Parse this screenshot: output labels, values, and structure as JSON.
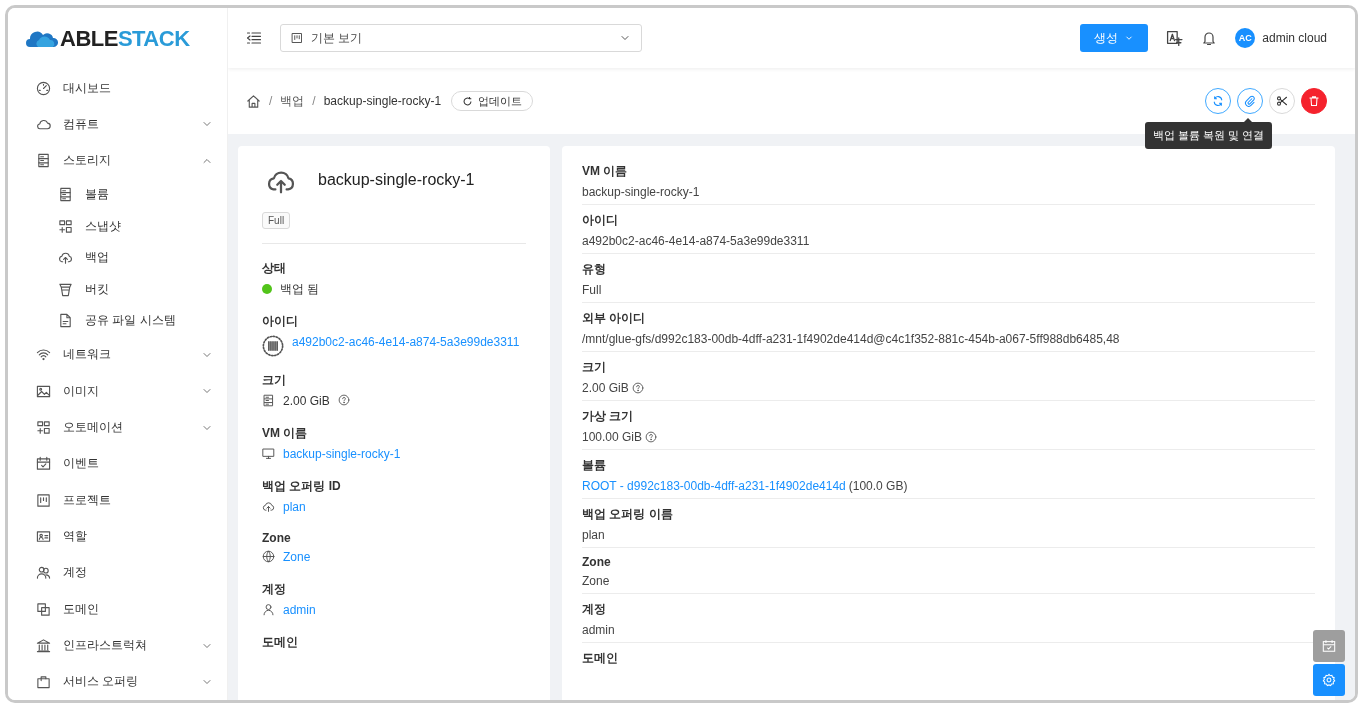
{
  "logo": {
    "first": "ABLE",
    "second": "STACK"
  },
  "sidebar": {
    "items": [
      {
        "label": "대시보드",
        "kind": "link"
      },
      {
        "label": "컴퓨트",
        "kind": "group",
        "expanded": false
      },
      {
        "label": "스토리지",
        "kind": "group",
        "expanded": true,
        "children": [
          {
            "label": "볼륨"
          },
          {
            "label": "스냅샷"
          },
          {
            "label": "백업"
          },
          {
            "label": "버킷"
          },
          {
            "label": "공유 파일 시스템"
          }
        ]
      },
      {
        "label": "네트워크",
        "kind": "group",
        "expanded": false
      },
      {
        "label": "이미지",
        "kind": "group",
        "expanded": false
      },
      {
        "label": "오토메이션",
        "kind": "group",
        "expanded": false
      },
      {
        "label": "이벤트",
        "kind": "link"
      },
      {
        "label": "프로젝트",
        "kind": "link"
      },
      {
        "label": "역할",
        "kind": "link"
      },
      {
        "label": "계정",
        "kind": "link"
      },
      {
        "label": "도메인",
        "kind": "link"
      },
      {
        "label": "인프라스트럭쳐",
        "kind": "group",
        "expanded": false
      },
      {
        "label": "서비스 오퍼링",
        "kind": "group",
        "expanded": false
      }
    ]
  },
  "header": {
    "view_select": {
      "value": "기본 보기"
    },
    "create_button": "생성",
    "user": {
      "initials": "AC",
      "name": "admin cloud"
    }
  },
  "breadcrumb": {
    "separator": "/",
    "items": [
      "백업",
      "backup-single-rocky-1"
    ],
    "refresh_button": "업데이트"
  },
  "actions": [
    {
      "kind": "reload"
    },
    {
      "kind": "attach"
    },
    {
      "kind": "cut"
    },
    {
      "kind": "delete"
    }
  ],
  "tooltip": "백업 볼륨 복원 및 연결",
  "summary": {
    "title": "backup-single-rocky-1",
    "tag": "Full",
    "fields": [
      {
        "label": "상태",
        "kind": "status",
        "value": "백업 됨",
        "color": "#52c41a"
      },
      {
        "label": "아이디",
        "kind": "id",
        "value": "a492b0c2-ac46-4e14-a874-5a3e99de3311"
      },
      {
        "label": "크기",
        "kind": "size",
        "value": "2.00 GiB"
      },
      {
        "label": "VM 이름",
        "kind": "vm",
        "value": "backup-single-rocky-1"
      },
      {
        "label": "백업 오퍼링 ID",
        "kind": "offering",
        "value": "plan"
      },
      {
        "label": "Zone",
        "kind": "zone",
        "value": "Zone"
      },
      {
        "label": "계정",
        "kind": "account",
        "value": "admin"
      },
      {
        "label": "도메인",
        "kind": "label"
      }
    ]
  },
  "details": {
    "rows": [
      {
        "label": "VM 이름",
        "kind": "text",
        "value": "backup-single-rocky-1",
        "help": false
      },
      {
        "label": "아이디",
        "kind": "text",
        "value": "a492b0c2-ac46-4e14-a874-5a3e99de3311",
        "help": false
      },
      {
        "label": "유형",
        "kind": "text",
        "value": "Full",
        "help": false
      },
      {
        "label": "외부 아이디",
        "kind": "text",
        "value": "/mnt/glue-gfs/d992c183-00db-4dff-a231-1f4902de414d@c4c1f352-881c-454b-a067-5ff988db6485,48",
        "help": false
      },
      {
        "label": "크기",
        "kind": "text",
        "value": "2.00 GiB",
        "help": true
      },
      {
        "label": "가상 크기",
        "kind": "text",
        "value": "100.00 GiB",
        "help": true
      },
      {
        "label": "볼륨",
        "kind": "link",
        "value": "ROOT - d992c183-00db-4dff-a231-1f4902de414d",
        "suffix": "(100.0 GB)",
        "help": false
      },
      {
        "label": "백업 오퍼링 이름",
        "kind": "text",
        "value": "plan",
        "help": false
      },
      {
        "label": "Zone",
        "kind": "text",
        "value": "Zone",
        "help": false
      },
      {
        "label": "계정",
        "kind": "text",
        "value": "admin",
        "help": false
      },
      {
        "label": "도메인",
        "kind": "label"
      }
    ]
  }
}
